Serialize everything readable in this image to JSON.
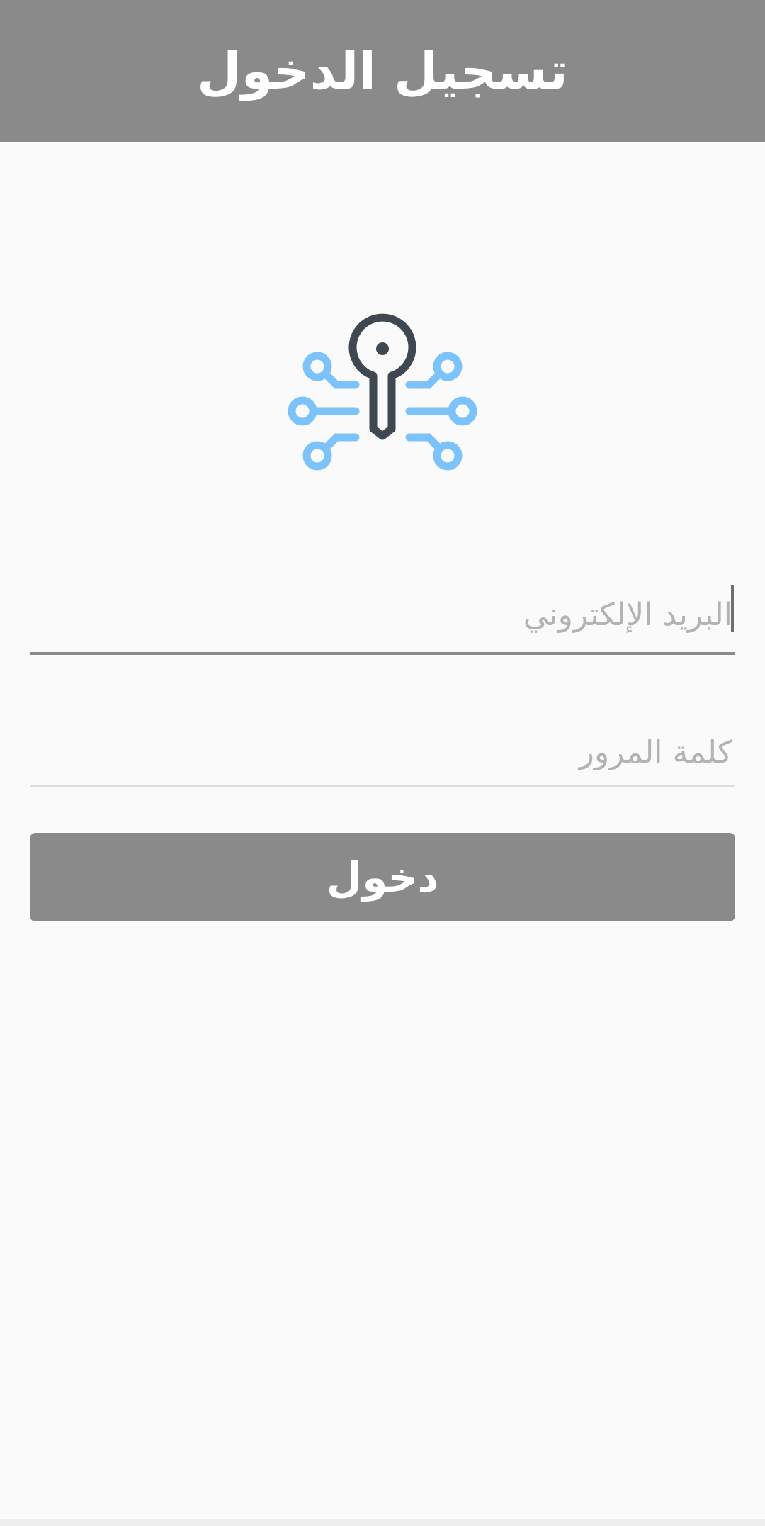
{
  "app_bar": {
    "title": "تسجيل الدخول",
    "background_color": "#898a89"
  },
  "logo": {
    "icon": "key-network-icon",
    "accent_color": "#7cc2fb",
    "key_color": "#3f4751"
  },
  "form": {
    "email_placeholder": "البريد الإلكتروني",
    "email_value": "",
    "password_placeholder": "كلمة المرور",
    "password_value": ""
  },
  "login_button": {
    "label": "دخول",
    "color": "#898a89"
  }
}
